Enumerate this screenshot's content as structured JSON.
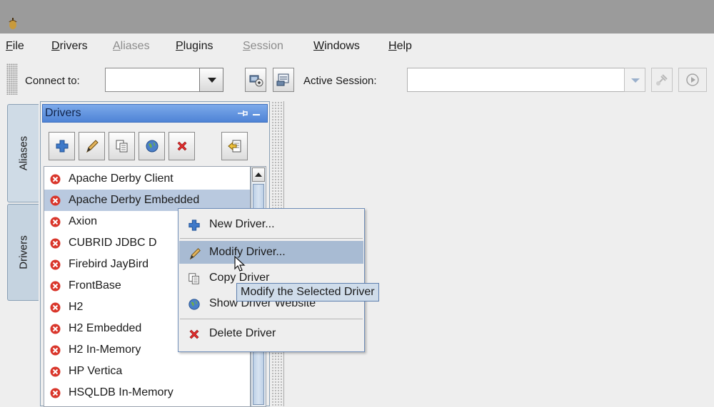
{
  "menubar": [
    {
      "label": "File",
      "mnemonic": "F",
      "rest": "ile",
      "enabled": true
    },
    {
      "label": "Drivers",
      "mnemonic": "D",
      "rest": "rivers",
      "enabled": true
    },
    {
      "label": "Aliases",
      "mnemonic": "A",
      "rest": "liases",
      "enabled": false
    },
    {
      "label": "Plugins",
      "mnemonic": "P",
      "rest": "lugins",
      "enabled": true
    },
    {
      "label": "Session",
      "mnemonic": "S",
      "rest": "ession",
      "enabled": false
    },
    {
      "label": "Windows",
      "mnemonic": "W",
      "rest": "indows",
      "enabled": true
    },
    {
      "label": "Help",
      "mnemonic": "H",
      "rest": "elp",
      "enabled": true
    }
  ],
  "toolbar": {
    "connect_label": "Connect to:",
    "connect_value": "",
    "active_session_label": "Active Session:",
    "active_session_value": ""
  },
  "left_tabs": {
    "aliases": "Aliases",
    "drivers": "Drivers"
  },
  "drivers_panel": {
    "title": "Drivers",
    "tools": [
      "add-icon",
      "pencil-icon",
      "copy-icon",
      "globe-icon",
      "delete-icon",
      "import-icon"
    ],
    "items": [
      {
        "label": "Apache Derby Client",
        "status": "error"
      },
      {
        "label": "Apache Derby Embedded",
        "status": "error",
        "selected": true
      },
      {
        "label": "Axion",
        "status": "error"
      },
      {
        "label": "CUBRID JDBC D",
        "status": "error"
      },
      {
        "label": "Firebird JayBird",
        "status": "error"
      },
      {
        "label": "FrontBase",
        "status": "error"
      },
      {
        "label": "H2",
        "status": "error"
      },
      {
        "label": "H2 Embedded",
        "status": "error"
      },
      {
        "label": "H2 In-Memory",
        "status": "error"
      },
      {
        "label": "HP Vertica",
        "status": "error"
      },
      {
        "label": "HSQLDB In-Memory",
        "status": "error"
      }
    ]
  },
  "context_menu": {
    "new_driver": "New Driver...",
    "modify_driver": "Modify Driver...",
    "copy_driver": "Copy Driver",
    "show_website": "Show Driver Website",
    "delete_driver": "Delete Driver"
  },
  "tooltip": "Modify the Selected Driver",
  "colors": {
    "error_red": "#d9362b",
    "selection": "#b9c9df",
    "header_blue": "#5b8fdd"
  }
}
